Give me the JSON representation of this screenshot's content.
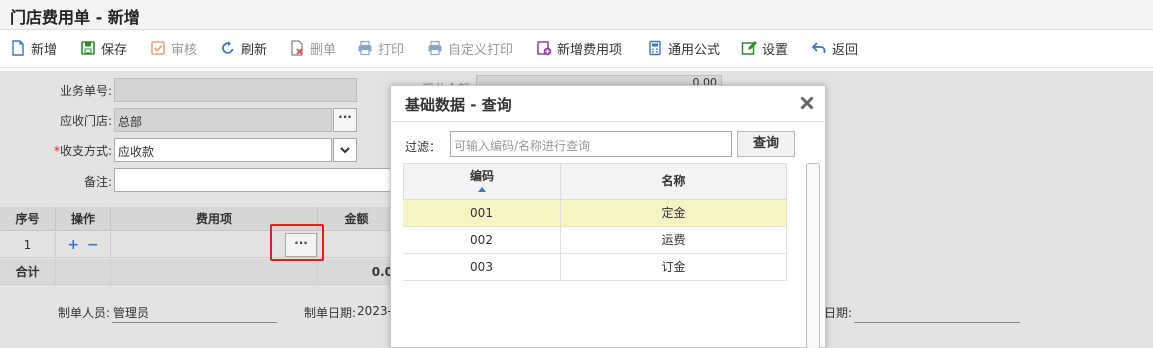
{
  "page": {
    "title": "门店费用单 - 新增"
  },
  "toolbar": {
    "add": "新增",
    "save": "保存",
    "audit": "审核",
    "refresh": "刷新",
    "delete": "删单",
    "print": "打印",
    "custom_print": "自定义打印",
    "add_fee_item": "新增费用项",
    "formula": "通用公式",
    "settings": "设置",
    "back": "返回"
  },
  "form": {
    "biz_no_label": "业务单号:",
    "biz_no_value": "",
    "store_label": "应收门店:",
    "store_value": "总部",
    "pay_method_label": "收支方式:",
    "pay_method_value": "应收款",
    "required_mark": "*",
    "remark_label": "备注:",
    "remark_value": "",
    "hidden_label_partial": "汇总金额:",
    "hidden_value_partial": "0.00"
  },
  "grid": {
    "headers": [
      "序号",
      "操作",
      "费用项",
      "金额"
    ],
    "rows": [
      {
        "seq": "1",
        "fee_item": "",
        "amount": ""
      }
    ],
    "total_label": "合计",
    "total_amount": "0.0"
  },
  "footer": {
    "creator_label": "制单人员:",
    "creator_value": "管理员",
    "create_date_label": "制单日期:",
    "create_date_value": "2023-",
    "other_date_label": "日期:",
    "other_date_value": ""
  },
  "modal": {
    "title": "基础数据 - 查询",
    "filter_label": "过滤：",
    "filter_placeholder": "可输入编码/名称进行查询",
    "query_button": "查询",
    "columns": [
      "编码",
      "名称"
    ],
    "rows": [
      {
        "code": "001",
        "name": "定金"
      },
      {
        "code": "002",
        "name": "运费"
      },
      {
        "code": "003",
        "name": "订金"
      }
    ]
  },
  "colors": {
    "accent": "#3a78c3",
    "highlight": "#f6f4c3",
    "red_box": "#e0201a",
    "disabled": "#999999"
  }
}
